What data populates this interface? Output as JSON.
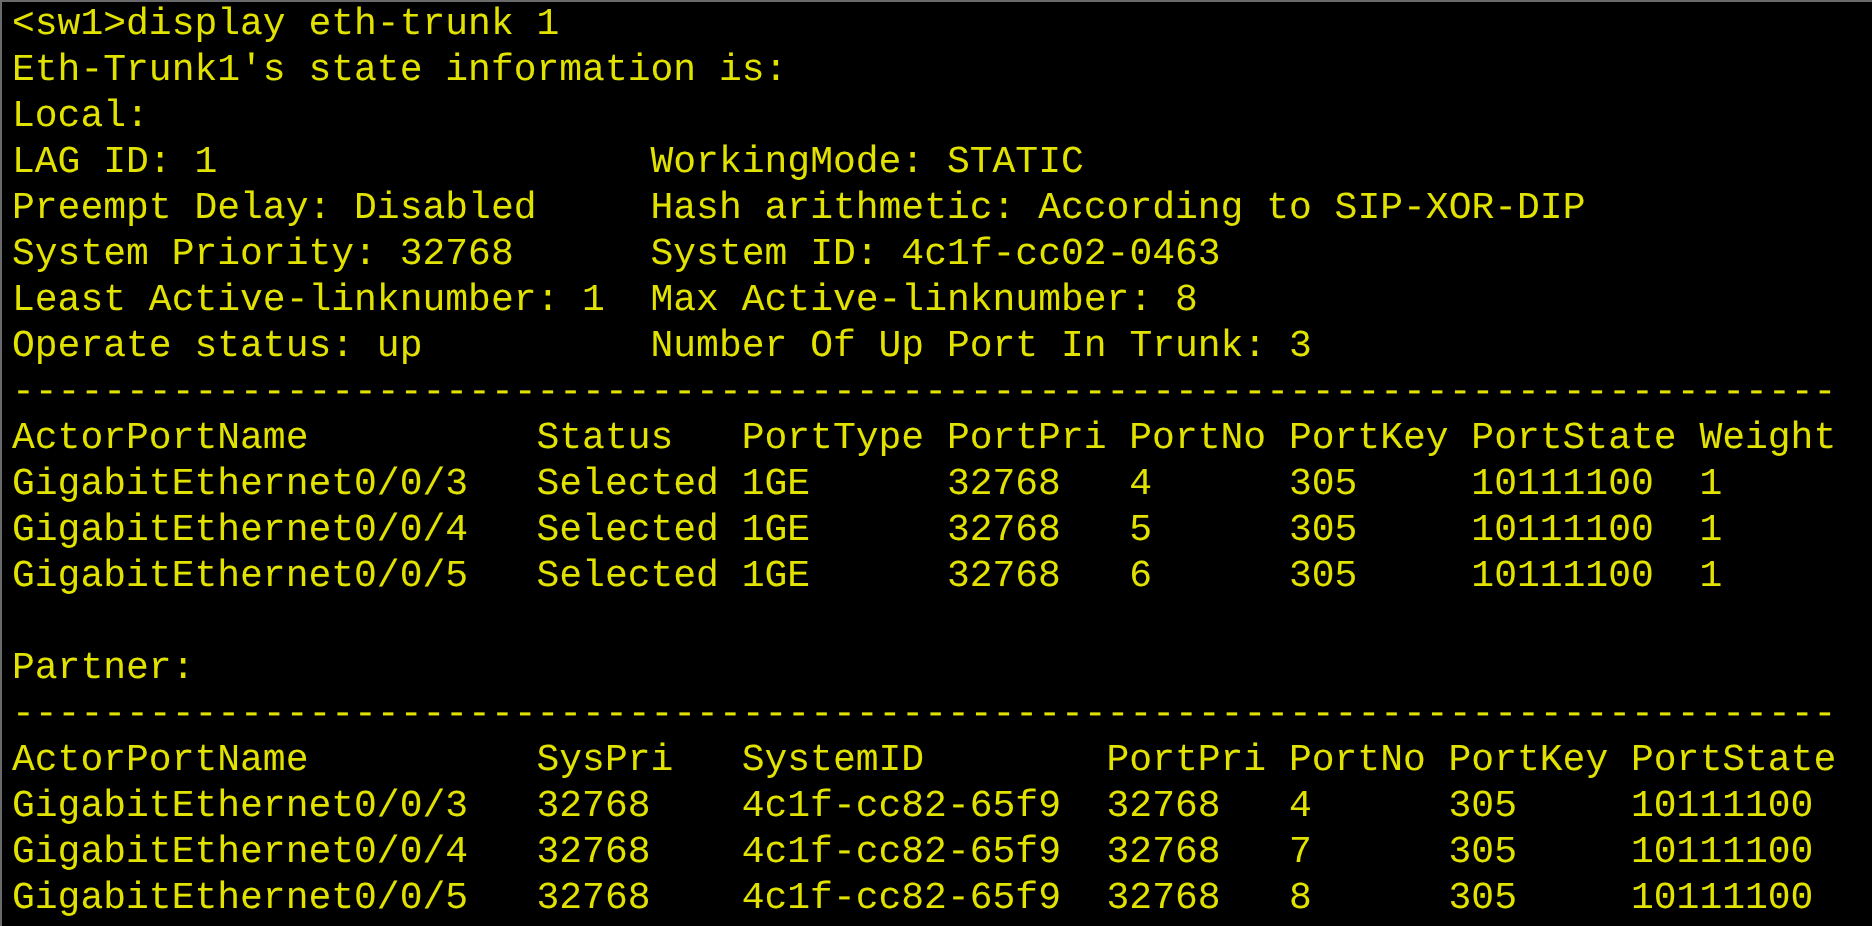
{
  "terminal": {
    "command": "<sw1>display eth-trunk 1",
    "heading": "Eth-Trunk1's state information is:",
    "local": {
      "label": "Local:",
      "info": [
        [
          "LAG ID: 1",
          "WorkingMode: STATIC"
        ],
        [
          "Preempt Delay: Disabled",
          "Hash arithmetic: According to SIP-XOR-DIP"
        ],
        [
          "System Priority: 32768",
          "System ID: 4c1f-cc02-0463"
        ],
        [
          "Least Active-linknumber: 1",
          "Max Active-linknumber: 8"
        ],
        [
          "Operate status: up",
          "Number Of Up Port In Trunk: 3"
        ]
      ],
      "rule": "--------------------------------------------------------------------------------",
      "columns": [
        "ActorPortName",
        "Status",
        "PortType",
        "PortPri",
        "PortNo",
        "PortKey",
        "PortState",
        "Weight"
      ],
      "rows": [
        [
          "GigabitEthernet0/0/3",
          "Selected",
          "1GE",
          "32768",
          "4",
          "305",
          "10111100",
          "1"
        ],
        [
          "GigabitEthernet0/0/4",
          "Selected",
          "1GE",
          "32768",
          "5",
          "305",
          "10111100",
          "1"
        ],
        [
          "GigabitEthernet0/0/5",
          "Selected",
          "1GE",
          "32768",
          "6",
          "305",
          "10111100",
          "1"
        ]
      ]
    },
    "partner": {
      "label": "Partner:",
      "rule": "--------------------------------------------------------------------------------",
      "columns": [
        "ActorPortName",
        "SysPri",
        "SystemID",
        "PortPri",
        "PortNo",
        "PortKey",
        "PortState"
      ],
      "rows": [
        [
          "GigabitEthernet0/0/3",
          "32768",
          "4c1f-cc82-65f9",
          "32768",
          "4",
          "305",
          "10111100"
        ],
        [
          "GigabitEthernet0/0/4",
          "32768",
          "4c1f-cc82-65f9",
          "32768",
          "7",
          "305",
          "10111100"
        ],
        [
          "GigabitEthernet0/0/5",
          "32768",
          "4c1f-cc82-65f9",
          "32768",
          "8",
          "305",
          "10111100"
        ]
      ]
    }
  }
}
